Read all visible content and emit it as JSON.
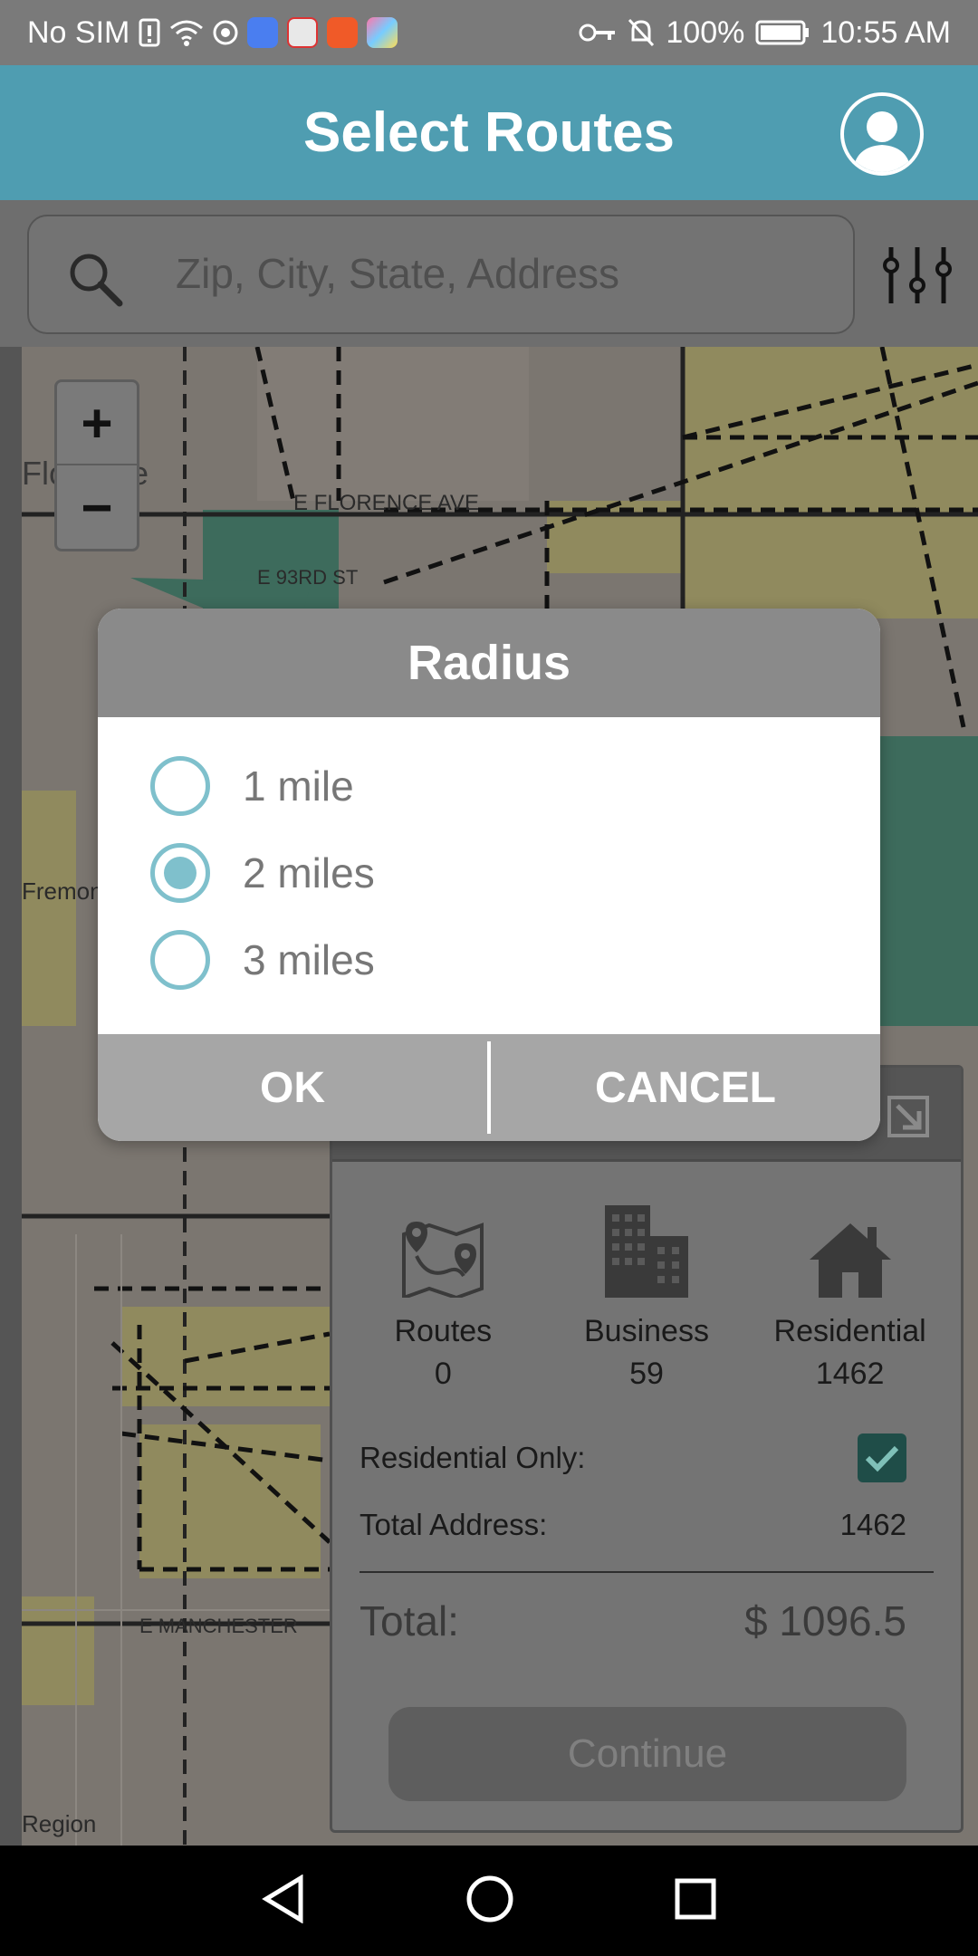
{
  "status_bar": {
    "carrier": "No SIM",
    "battery": "100%",
    "time": "10:55 AM"
  },
  "header": {
    "title": "Select Routes"
  },
  "search": {
    "placeholder": "Zip, City, State, Address"
  },
  "map_labels": {
    "street1": "E FLORENCE AVE",
    "street2": "E 93RD ST",
    "street3": "E MANCHESTER",
    "place1": "Florence",
    "place2": "Fremont School",
    "place3": "Region"
  },
  "dialog": {
    "title": "Radius",
    "options": [
      {
        "label": "1 mile",
        "selected": false
      },
      {
        "label": "2 miles",
        "selected": true
      },
      {
        "label": "3 miles",
        "selected": false
      }
    ],
    "ok_label": "OK",
    "cancel_label": "CANCEL"
  },
  "summary": {
    "stats": [
      {
        "label": "Routes",
        "value": "0",
        "icon": "map-pin-icon"
      },
      {
        "label": "Business",
        "value": "59",
        "icon": "building-icon"
      },
      {
        "label": "Residential",
        "value": "1462",
        "icon": "house-icon"
      }
    ],
    "residential_only_label": "Residential Only:",
    "residential_only_checked": true,
    "total_address_label": "Total Address:",
    "total_address_value": "1462",
    "total_label": "Total:",
    "total_value": "$ 1096.5",
    "continue_label": "Continue"
  },
  "colors": {
    "header": "#4f9db1",
    "radio_accent": "#7fc0cc",
    "checkbox": "#1f4d48"
  }
}
